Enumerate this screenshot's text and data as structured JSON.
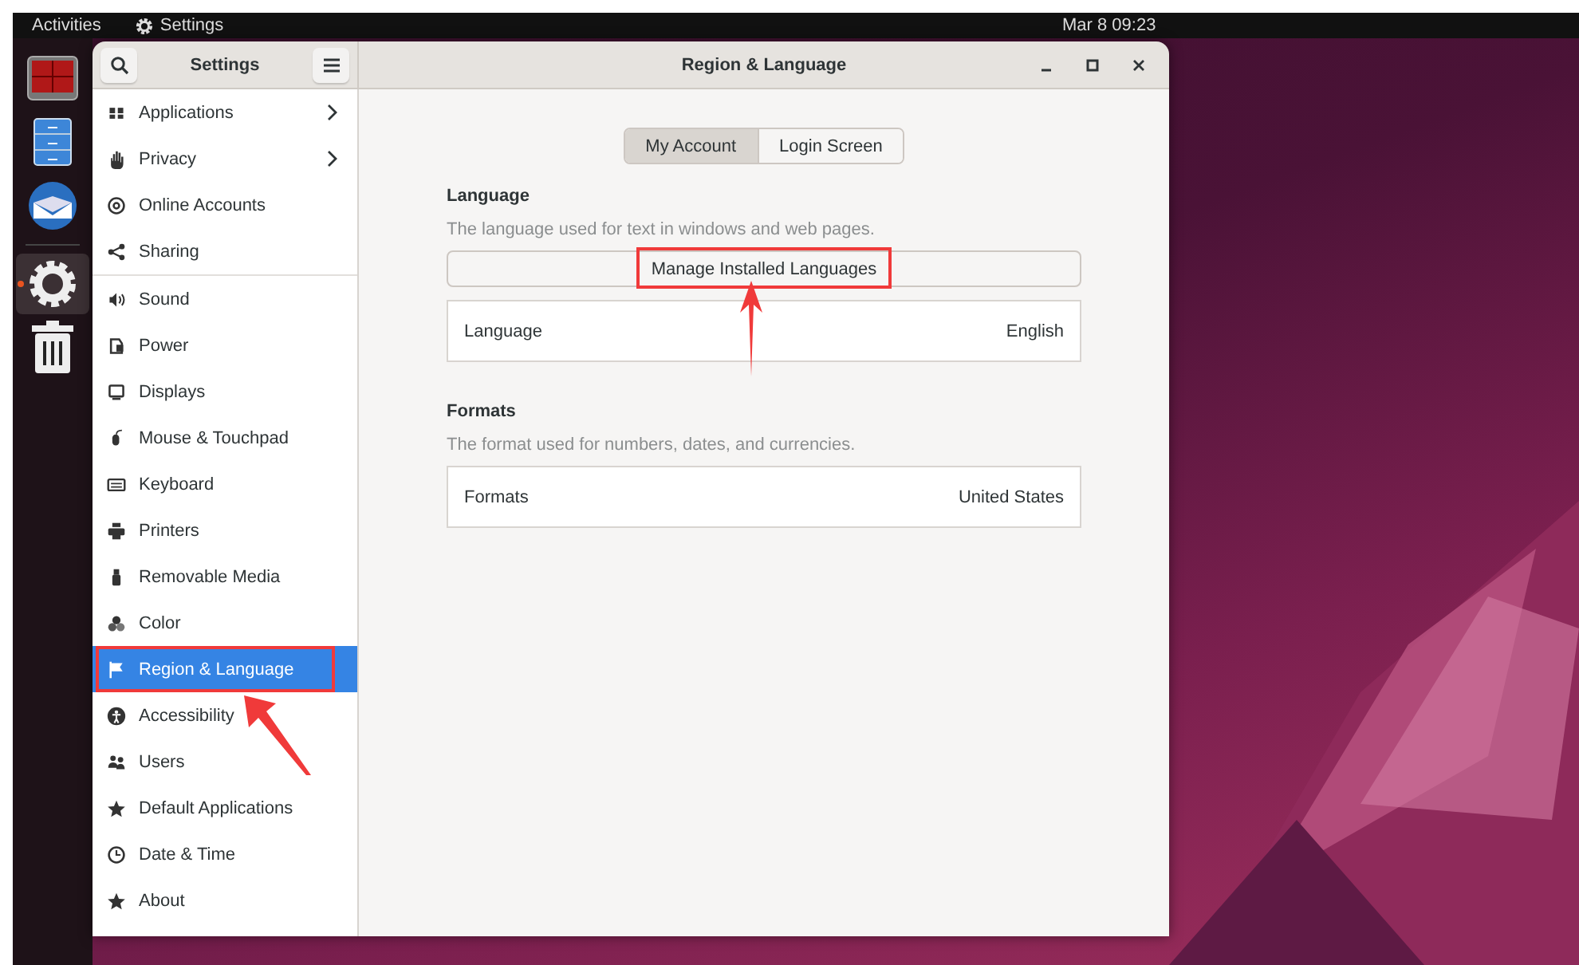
{
  "top_bar": {
    "activities": "Activities",
    "app_name": "Settings",
    "clock": "Mar 8  09:23"
  },
  "dock": [
    {
      "active": false
    },
    {
      "active": false
    },
    {
      "active": false
    },
    {
      "active": true
    },
    {
      "active": false
    }
  ],
  "window": {
    "sidebar_title": "Settings",
    "title": "Region & Language"
  },
  "sidebar": {
    "groups": [
      [
        {
          "label": "Applications",
          "chevron": true,
          "selected": false,
          "highlighted": false
        },
        {
          "label": "Privacy",
          "chevron": true,
          "selected": false,
          "highlighted": false
        },
        {
          "label": "Online Accounts",
          "chevron": false,
          "selected": false,
          "highlighted": false
        },
        {
          "label": "Sharing",
          "chevron": false,
          "selected": false,
          "highlighted": false
        }
      ],
      [
        {
          "label": "Sound",
          "chevron": false,
          "selected": false,
          "highlighted": false
        },
        {
          "label": "Power",
          "chevron": false,
          "selected": false,
          "highlighted": false
        },
        {
          "label": "Displays",
          "chevron": false,
          "selected": false,
          "highlighted": false
        },
        {
          "label": "Mouse & Touchpad",
          "chevron": false,
          "selected": false,
          "highlighted": false
        },
        {
          "label": "Keyboard",
          "chevron": false,
          "selected": false,
          "highlighted": false
        },
        {
          "label": "Printers",
          "chevron": false,
          "selected": false,
          "highlighted": false
        },
        {
          "label": "Removable Media",
          "chevron": false,
          "selected": false,
          "highlighted": false
        },
        {
          "label": "Color",
          "chevron": false,
          "selected": false,
          "highlighted": false
        },
        {
          "label": "Region & Language",
          "chevron": false,
          "selected": true,
          "highlighted": true
        },
        {
          "label": "Accessibility",
          "chevron": false,
          "selected": false,
          "highlighted": false
        },
        {
          "label": "Users",
          "chevron": false,
          "selected": false,
          "highlighted": false
        },
        {
          "label": "Default Applications",
          "chevron": false,
          "selected": false,
          "highlighted": false
        },
        {
          "label": "Date & Time",
          "chevron": false,
          "selected": false,
          "highlighted": false
        },
        {
          "label": "About",
          "chevron": false,
          "selected": false,
          "highlighted": false
        }
      ]
    ]
  },
  "tabs": [
    {
      "label": "My Account",
      "selected": true
    },
    {
      "label": "Login Screen",
      "selected": false
    }
  ],
  "sections": [
    {
      "heading": "Language",
      "description": "The language used for text in windows and web pages.",
      "button": {
        "label": "Manage Installed Languages",
        "highlighted": true
      },
      "row": {
        "label": "Language",
        "value": "English"
      }
    },
    {
      "heading": "Formats",
      "description": "The format used for numbers, dates, and currencies.",
      "row": {
        "label": "Formats",
        "value": "United States"
      }
    }
  ]
}
